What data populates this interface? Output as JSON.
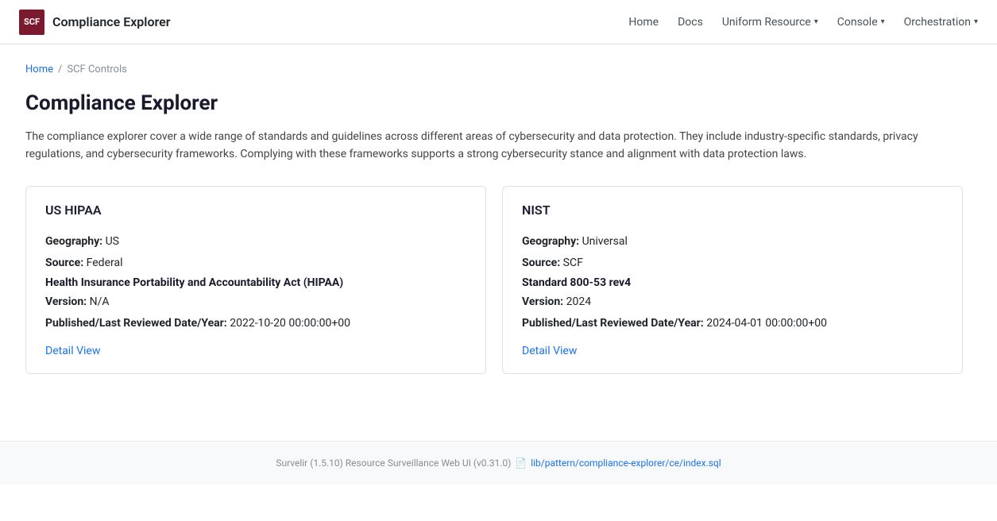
{
  "nav": {
    "logo_text": "SCF",
    "brand_title": "Compliance Explorer",
    "links": [
      {
        "label": "Home",
        "has_dropdown": false
      },
      {
        "label": "Docs",
        "has_dropdown": false
      },
      {
        "label": "Uniform Resource",
        "has_dropdown": true
      },
      {
        "label": "Console",
        "has_dropdown": true
      },
      {
        "label": "Orchestration",
        "has_dropdown": true
      }
    ]
  },
  "breadcrumb": {
    "home_label": "Home",
    "separator": "/",
    "current": "SCF Controls"
  },
  "page": {
    "title": "Compliance Explorer",
    "description": "The compliance explorer cover a wide range of standards and guidelines across different areas of cybersecurity and data protection. They include industry-specific standards, privacy regulations, and cybersecurity frameworks. Complying with these frameworks supports a strong cybersecurity stance and alignment with data protection laws."
  },
  "cards": [
    {
      "id": "us-hipaa",
      "title": "US HIPAA",
      "geography_label": "Geography:",
      "geography_value": "US",
      "source_label": "Source:",
      "source_value": "Federal",
      "standard_bold": "Health Insurance Portability and Accountability Act (HIPAA)",
      "version_label": "Version:",
      "version_value": "N/A",
      "published_label": "Published/Last Reviewed Date/Year:",
      "published_value": "2022-10-20 00:00:00+00",
      "detail_link": "Detail View"
    },
    {
      "id": "nist",
      "title": "NIST",
      "geography_label": "Geography:",
      "geography_value": "Universal",
      "source_label": "Source:",
      "source_value": "SCF",
      "standard_bold": "Standard 800-53 rev4",
      "version_label": "Version:",
      "version_value": "2024",
      "published_label": "Published/Last Reviewed Date/Year:",
      "published_value": "2024-04-01 00:00:00+00",
      "detail_link": "Detail View"
    }
  ],
  "footer": {
    "text": "Survelir (1.5.10) Resource Surveillance Web UI (v0.31.0)",
    "icon": "📄",
    "link_text": "lib/pattern/compliance-explorer/ce/index.sql",
    "link_href": "lib/pattern/compliance-explorer/ce/index.sql"
  }
}
